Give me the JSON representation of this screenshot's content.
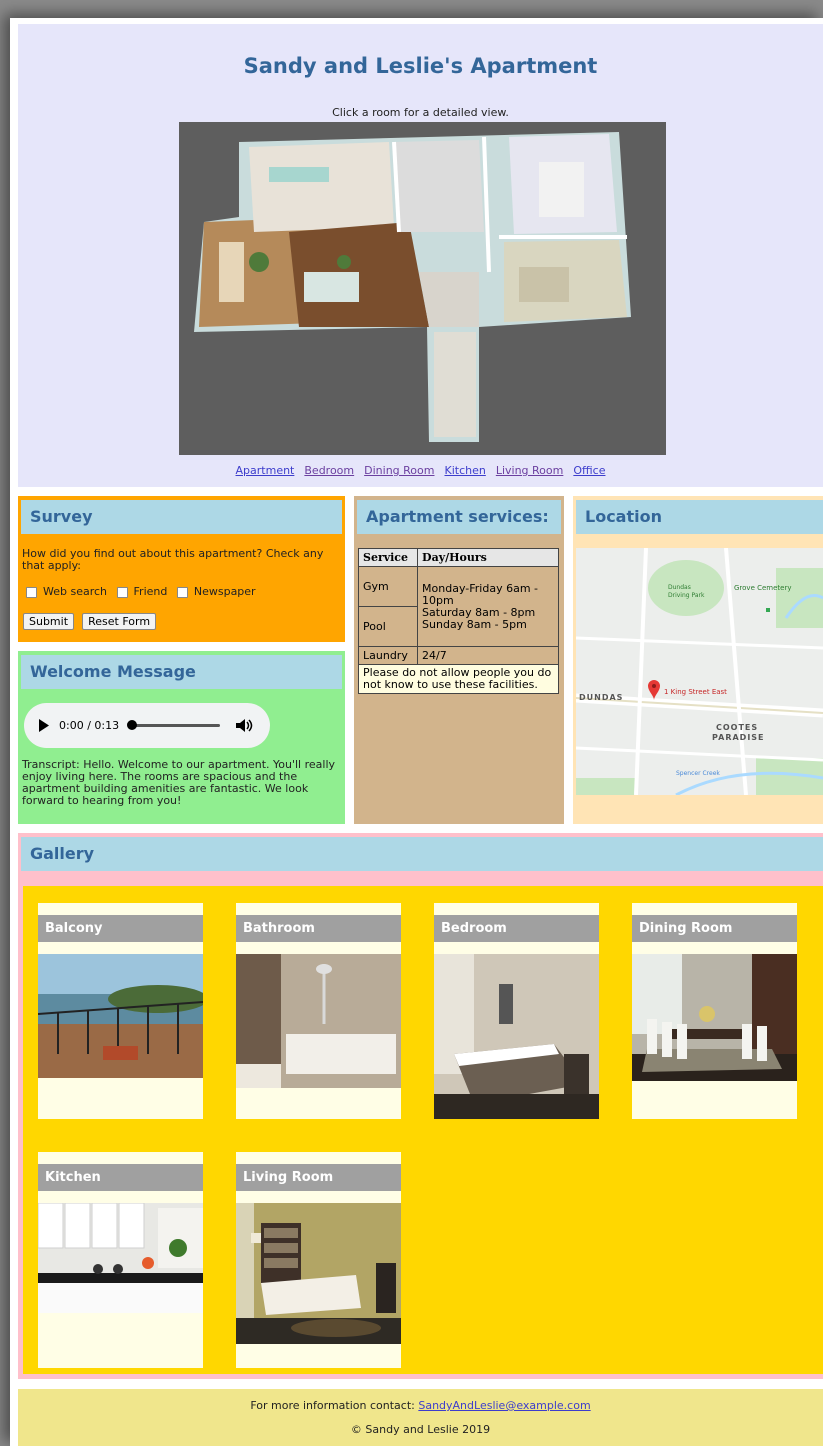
{
  "header": {
    "title": "Sandy and Leslie's Apartment",
    "subtitle": "Click a room for a detailed view.",
    "nav": [
      "Apartment",
      "Bedroom",
      "Dining Room",
      "Kitchen",
      "Living Room",
      "Office"
    ]
  },
  "survey": {
    "heading": "Survey",
    "question": "How did you find out about this apartment? Check any that apply:",
    "options": [
      "Web search",
      "Friend",
      "Newspaper"
    ],
    "submit_label": "Submit",
    "reset_label": "Reset Form"
  },
  "welcome": {
    "heading": "Welcome Message",
    "time": "0:00 / 0:13",
    "progress": 0,
    "transcript": "Transcript: Hello. Welcome to our apartment. You'll really enjoy living here. The rooms are spacious and the apartment building amenities are fantastic. We look forward to hearing from you!"
  },
  "services": {
    "heading": "Apartment services:",
    "columns": [
      "Service",
      "Day/Hours"
    ],
    "rows": [
      {
        "service": "Gym",
        "hours": "Monday-Friday 6am - 10pm"
      },
      {
        "service": "Pool",
        "hours": "Saturday 8am - 8pm Sunday 8am - 5pm"
      },
      {
        "service": "Laundry",
        "hours": "24/7"
      }
    ],
    "note": "Please do not allow people you do not know to use these facilities."
  },
  "location": {
    "heading": "Location",
    "map_labels": {
      "pin": "1 King Street East",
      "area1": "DUNDAS",
      "area2": "COOTES",
      "area3": "PARADISE",
      "park": "Dundas Driving Park",
      "cemetery": "Grove Cemetery",
      "creek": "Spencer Creek"
    }
  },
  "gallery": {
    "heading": "Gallery",
    "items": [
      "Balcony",
      "Bathroom",
      "Bedroom",
      "Dining Room",
      "Kitchen",
      "Living Room"
    ]
  },
  "footer": {
    "contact_prefix": "For more information contact: ",
    "email": "SandyAndLeslie@example.com",
    "copyright": "© Sandy and Leslie 2019"
  }
}
